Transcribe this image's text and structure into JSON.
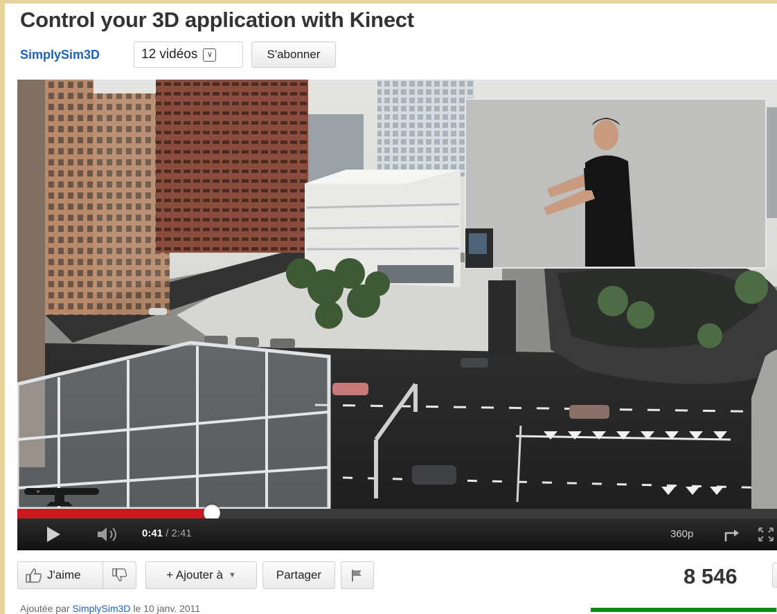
{
  "video": {
    "title": "Control your 3D application with Kinect"
  },
  "channel": {
    "name": "SimplySim3D",
    "videos_label": "12 vidéos",
    "subscribe_label": "S'abonner"
  },
  "player": {
    "current_time": "0:41",
    "duration": " / 2:41",
    "progress_fraction": 0.2547,
    "quality": "360p"
  },
  "actions": {
    "like_label": "J'aime",
    "add_to_label": "+ Ajouter à",
    "share_label": "Partager"
  },
  "stats": {
    "views": "8 546",
    "like_ratio": 0.985
  },
  "upload": {
    "prefix": "Ajoutée par ",
    "uploader": "SimplySim3D",
    "date_text": " le 10 janv. 2011"
  },
  "colors": {
    "channel_link": "#1c62b9",
    "progress": "#cc181e",
    "like_bar": "#0b8a15",
    "frame": "#e6d49a"
  },
  "icons": {
    "videos_dropdown": "chevron-down-box-icon",
    "like": "thumbs-up-icon",
    "dislike": "thumbs-down-icon",
    "flag": "flag-icon",
    "stats": "stats-chart-icon",
    "play": "play-icon",
    "volume": "volume-icon",
    "popout": "popout-icon",
    "fullscreen": "fullscreen-icon"
  }
}
